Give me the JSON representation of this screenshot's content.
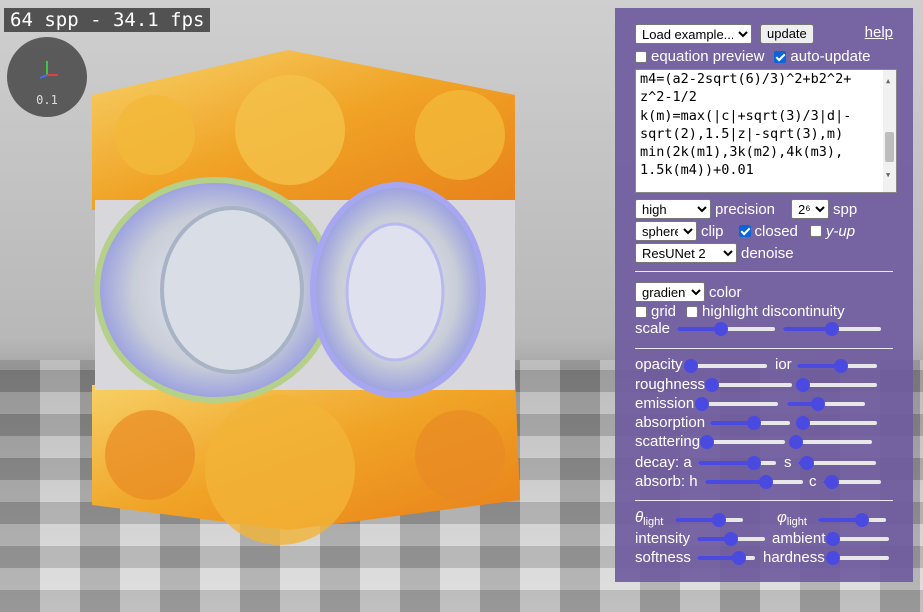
{
  "stats": "64 spp - 34.1 fps",
  "gizmo": {
    "label": "0.1"
  },
  "panel": {
    "load_example": "Load example...",
    "update": "update",
    "help": "help",
    "equation_preview": {
      "label": "equation preview",
      "checked": false
    },
    "auto_update": {
      "label": "auto-update",
      "checked": true
    },
    "equation_lines": [
      "m4=(a2-2sqrt(6)/3)^2+b2^2+",
      "z^2-1/2",
      "k(m)=max(|c|+sqrt(3)/3|d|-",
      "sqrt(2),1.5|z|-sqrt(3),m)",
      "min(2k(m1),3k(m2),4k(m3),",
      "1.5k(m4))+0.01"
    ],
    "precision": {
      "value": "high",
      "label": "precision"
    },
    "spp": {
      "value": "2⁶",
      "label": "spp"
    },
    "clip": {
      "value": "sphere",
      "label": "clip"
    },
    "closed": {
      "label": "closed",
      "checked": true
    },
    "y_up": {
      "label": "y-up",
      "checked": false
    },
    "denoise": {
      "value": "ResUNet 2",
      "label": "denoise"
    },
    "color": {
      "value": "gradient",
      "label": "color"
    },
    "grid": {
      "label": "grid",
      "checked": false
    },
    "highlight": {
      "label": "highlight discontinuity",
      "checked": false
    },
    "sliders": {
      "scale": {
        "label": "scale",
        "a": 0.45,
        "b": 0.5
      },
      "opacity": {
        "label": "opacity",
        "value": 0.05
      },
      "ior": {
        "label": "ior",
        "value": 0.55
      },
      "roughness": {
        "label": "roughness",
        "value": 0.03
      },
      "roughness_b": {
        "value": 0.08
      },
      "emission": {
        "label": "emission",
        "value": 0.02
      },
      "emission_b": {
        "value": 0.4
      },
      "absorption": {
        "label": "absorption",
        "value": 0.55
      },
      "absorption_b": {
        "value": 0.08
      },
      "scattering": {
        "label": "scattering",
        "value": 0.02
      },
      "scattering_b": {
        "value": 0.05
      },
      "decay_a": {
        "label": "decay: a",
        "value": 0.72
      },
      "decay_s": {
        "label": "s",
        "value": 0.12
      },
      "absorb_h": {
        "label": "absorb: h",
        "value": 0.62
      },
      "absorb_c": {
        "label": "c",
        "value": 0.15
      },
      "theta": {
        "label": "θ",
        "sub": "light",
        "value": 0.65
      },
      "phi": {
        "label": "φ",
        "sub": "light",
        "value": 0.65
      },
      "intensity": {
        "label": "intensity",
        "value": 0.5
      },
      "ambient": {
        "label": "ambient",
        "value": 0.03
      },
      "softness": {
        "label": "softness",
        "value": 0.72
      },
      "hardness": {
        "label": "hardness",
        "value": 0.03
      }
    }
  }
}
